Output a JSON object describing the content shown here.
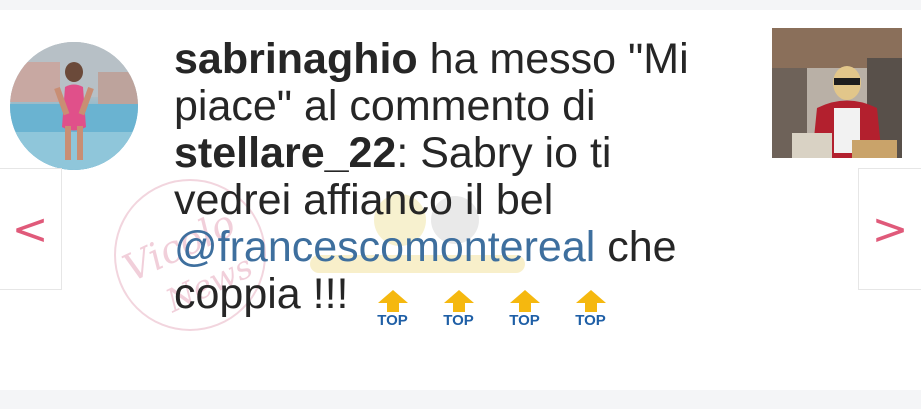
{
  "nav": {
    "prev": "<",
    "next": ">"
  },
  "message": {
    "actor": "sabrinaghio",
    "action": "ha messo \"Mi piace\" al commento di",
    "commenter": "stellare_22",
    "comment_text": ": Sabry io ti vedrei affianco il bel",
    "mention": "@francescomontereal",
    "comment_end": "che coppia !!!"
  },
  "top_badges": [
    {
      "label": "TOP"
    },
    {
      "label": "TOP"
    },
    {
      "label": "TOP"
    },
    {
      "label": "TOP"
    }
  ],
  "colors": {
    "accent_nav": "#e05a7a",
    "mention": "#3e6f9e",
    "top_arrow": "#f5b80f"
  }
}
